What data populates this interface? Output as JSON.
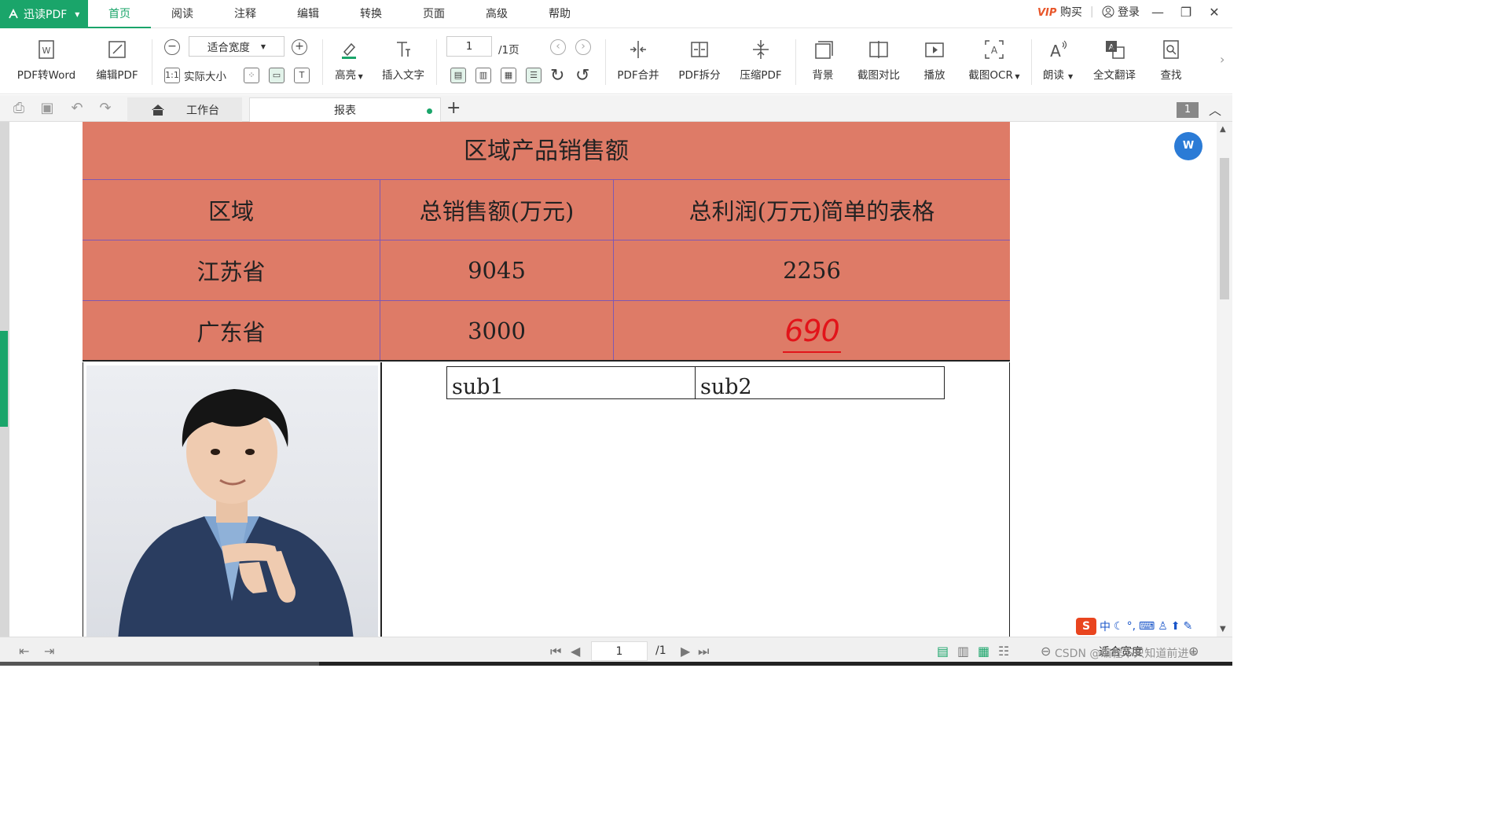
{
  "app": {
    "name": "迅读PDF"
  },
  "menu": {
    "tabs": [
      "首页",
      "阅读",
      "注释",
      "编辑",
      "转换",
      "页面",
      "高级",
      "帮助"
    ],
    "active": "首页"
  },
  "topright": {
    "vip": "VIP",
    "buy": "购买",
    "login": "登录",
    "minimize": "—",
    "restore": "❐",
    "close": "✕"
  },
  "toolbar": {
    "pdf_to_word": "PDF转Word",
    "edit_pdf": "编辑PDF",
    "zoom_select": "适合宽度",
    "actual_size": "实际大小",
    "highlight": "高亮",
    "insert_text": "插入文字",
    "page_input": "1",
    "page_total": "/1页",
    "pdf_merge": "PDF合并",
    "pdf_split": "PDF拆分",
    "compress_pdf": "压缩PDF",
    "background": "背景",
    "screenshot_compare": "截图对比",
    "play": "播放",
    "screenshot_ocr": "截图OCR",
    "read_aloud": "朗读",
    "translate": "全文翻译",
    "find": "查找"
  },
  "tabs": {
    "home": "工作台",
    "active_doc": "报表",
    "page_badge": "1"
  },
  "document": {
    "title": "区域产品销售额",
    "headers": [
      "区域",
      "总销售额(万元)",
      "总利润(万元)简单的表格"
    ],
    "rows": [
      [
        "江苏省",
        "9045",
        "2256"
      ],
      [
        "广东省",
        "3000",
        "690"
      ]
    ],
    "subtable": [
      "sub1",
      "sub2"
    ]
  },
  "statusbar": {
    "page": "1",
    "total": "/1",
    "zoom": "适合宽度",
    "watermark": "CSDN @编程不只知道前进~"
  },
  "ime": {
    "logo": "S",
    "lang": "中"
  },
  "colors": {
    "accent": "#1aa56a",
    "table_fill": "#de7b67",
    "highlight_red": "#e2141a"
  }
}
